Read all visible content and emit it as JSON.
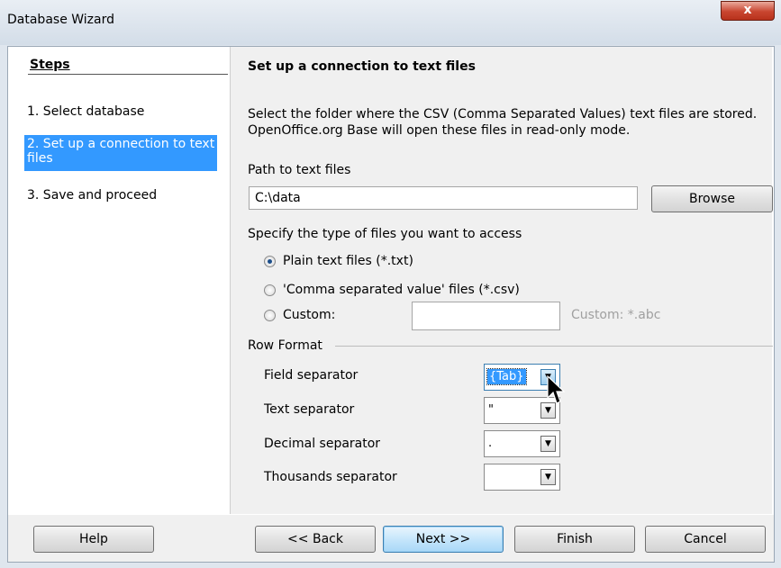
{
  "window": {
    "title": "Database Wizard",
    "close_symbol": "x"
  },
  "steps": {
    "heading": "Steps",
    "items": [
      {
        "label": "1. Select database"
      },
      {
        "label": "2. Set up a connection to text files",
        "active": true
      },
      {
        "label": "3. Save and proceed"
      }
    ]
  },
  "content": {
    "title": "Set up a connection to text files",
    "description": "Select the folder where the CSV (Comma Separated Values) text files are stored. OpenOffice.org Base will open these files in read-only mode.",
    "path_label": "Path to text files",
    "path_value": "C:\\data",
    "browse_label": "Browse",
    "file_type_label": "Specify the type of files you want to access",
    "file_types": [
      {
        "label": "Plain text files (*.txt)",
        "selected": true
      },
      {
        "label": "'Comma separated value' files (*.csv)",
        "selected": false
      },
      {
        "label": "Custom:",
        "selected": false
      }
    ],
    "custom_value": "",
    "custom_hint": "Custom: *.abc",
    "row_format_label": "Row Format",
    "separators": {
      "field": {
        "label": "Field separator",
        "value": "{Tab}"
      },
      "text": {
        "label": "Text separator",
        "value": "\""
      },
      "decimal": {
        "label": "Decimal separator",
        "value": "."
      },
      "thousands": {
        "label": "Thousands separator",
        "value": ""
      }
    }
  },
  "footer": {
    "help": "Help",
    "back": "<< Back",
    "next": "Next >>",
    "finish": "Finish",
    "cancel": "Cancel"
  },
  "colors": {
    "selection": "#3399ff",
    "close_button": "#c8452f"
  }
}
